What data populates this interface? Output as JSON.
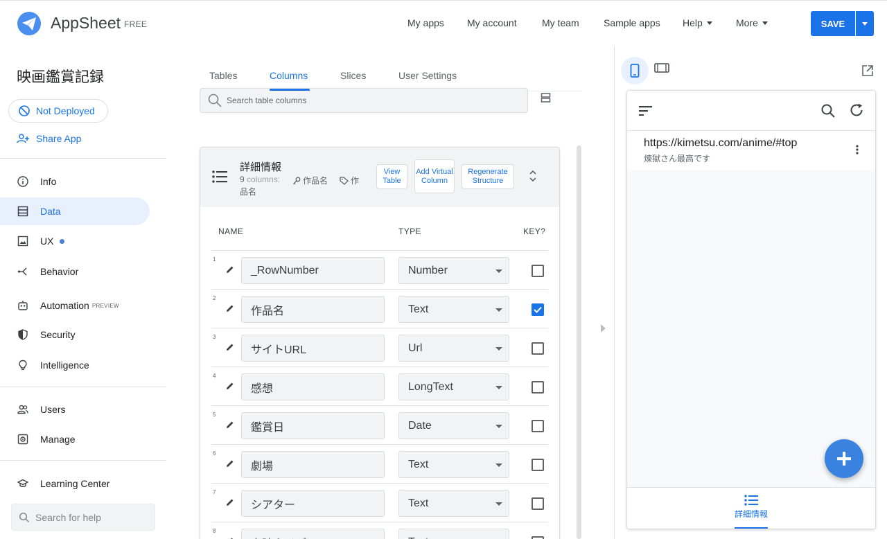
{
  "header": {
    "brand": "AppSheet",
    "plan": "FREE",
    "nav": [
      "My apps",
      "My account",
      "My team",
      "Sample apps",
      "Help",
      "More"
    ],
    "save_label": "SAVE"
  },
  "sidebar": {
    "app_name": "映画鑑賞記録",
    "deploy_status": "Not Deployed",
    "share_label": "Share App",
    "items": [
      {
        "label": "Info",
        "icon": "info-icon"
      },
      {
        "label": "Data",
        "icon": "table-icon"
      },
      {
        "label": "UX",
        "icon": "image-icon"
      },
      {
        "label": "Behavior",
        "icon": "branch-icon"
      },
      {
        "label": "Automation",
        "icon": "robot-icon",
        "badge": "PREVIEW"
      },
      {
        "label": "Security",
        "icon": "shield-icon"
      },
      {
        "label": "Intelligence",
        "icon": "bulb-icon"
      },
      {
        "label": "Users",
        "icon": "users-icon"
      },
      {
        "label": "Manage",
        "icon": "manage-icon"
      },
      {
        "label": "Learning Center",
        "icon": "graduation-icon"
      }
    ],
    "help_search_placeholder": "Search for help"
  },
  "main": {
    "tabs": [
      "Tables",
      "Columns",
      "Slices",
      "User Settings"
    ],
    "active_tab": "Columns",
    "search_placeholder": "Search table columns",
    "table": {
      "name": "詳細情報",
      "columns_count": "9",
      "columns_word": "columns:",
      "key_col": "作品名",
      "key_col_wrap": "品名",
      "label_col": "作",
      "buttons": {
        "view_table": "View Table",
        "add_virtual": "Add Virtual Column",
        "regenerate": "Regenerate Structure"
      },
      "headers": {
        "name": "NAME",
        "type": "TYPE",
        "key": "KEY?"
      },
      "rows": [
        {
          "num": "1",
          "name": "_RowNumber",
          "type": "Number",
          "key": false
        },
        {
          "num": "2",
          "name": "作品名",
          "type": "Text",
          "key": true
        },
        {
          "num": "3",
          "name": "サイトURL",
          "type": "Url",
          "key": false
        },
        {
          "num": "4",
          "name": "感想",
          "type": "LongText",
          "key": false
        },
        {
          "num": "5",
          "name": "鑑賞日",
          "type": "Date",
          "key": false
        },
        {
          "num": "6",
          "name": "劇場",
          "type": "Text",
          "key": false
        },
        {
          "num": "7",
          "name": "シアター",
          "type": "Text",
          "key": false
        },
        {
          "num": "8",
          "name": "上映タイプ",
          "type": "Text",
          "key": false
        }
      ]
    }
  },
  "preview": {
    "items": [
      {
        "title": "https://kimetsu.com/anime/#top",
        "subtitle": "煉獄さん最高です"
      }
    ],
    "bottom_nav_label": "詳細情報"
  },
  "colors": {
    "accent": "#1a73e8",
    "active_bg": "#e8f0fe",
    "fab": "#3a82e0"
  }
}
